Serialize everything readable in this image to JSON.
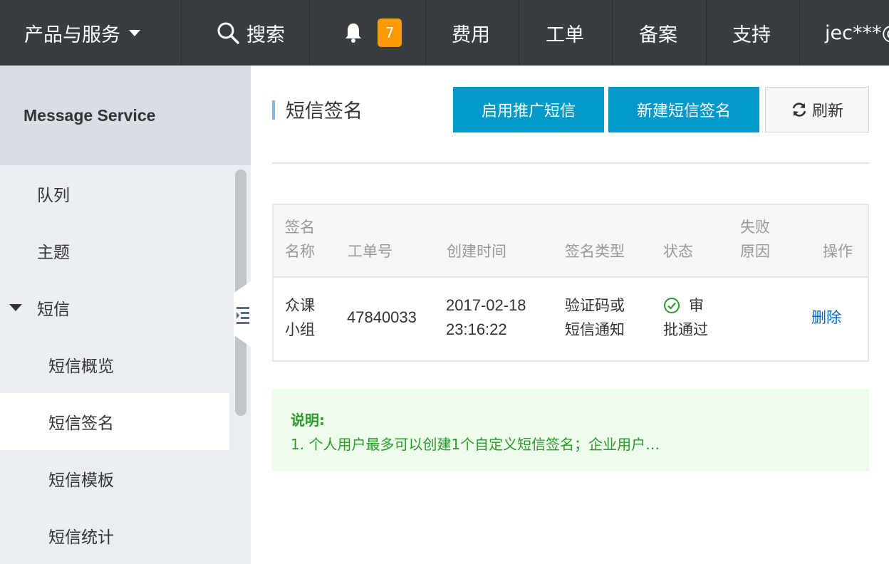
{
  "topbar": {
    "products": "产品与服务",
    "search": "搜索",
    "notification_count": "7",
    "fees": "费用",
    "tickets": "工单",
    "filing": "备案",
    "support": "支持",
    "user": "jec***@"
  },
  "sidebar": {
    "title": "Message Service",
    "items": [
      {
        "label": "队列"
      },
      {
        "label": "主题"
      },
      {
        "label": "短信"
      },
      {
        "label": "短信概览"
      },
      {
        "label": "短信签名"
      },
      {
        "label": "短信模板"
      },
      {
        "label": "短信统计"
      }
    ]
  },
  "main": {
    "title": "短信签名",
    "btn_enable_promo": "启用推广短信",
    "btn_new_signature": "新建短信签名",
    "btn_refresh": "刷新"
  },
  "table": {
    "headers": {
      "name_1": "签名",
      "name_2": "名称",
      "ticket": "工单号",
      "created": "创建时间",
      "type": "签名类型",
      "status": "状态",
      "fail_1": "失败",
      "fail_2": "原因",
      "action": "操作"
    },
    "rows": [
      {
        "name_1": "众课",
        "name_2": "小组",
        "ticket": "47840033",
        "created_1": "2017-02-18",
        "created_2": "23:16:22",
        "type_1": "验证码或",
        "type_2": "短信通知",
        "status_1": "审",
        "status_2": "批通过",
        "action": "删除"
      }
    ]
  },
  "notice": {
    "title": "说明:",
    "text": "1. 个人用户最多可以创建1个自定义短信签名；企业用户…"
  },
  "colors": {
    "topbar": "#373d41",
    "primary": "#0099cc",
    "badge": "#ff9900",
    "success": "#2b9a2b",
    "link": "#0066cc"
  }
}
